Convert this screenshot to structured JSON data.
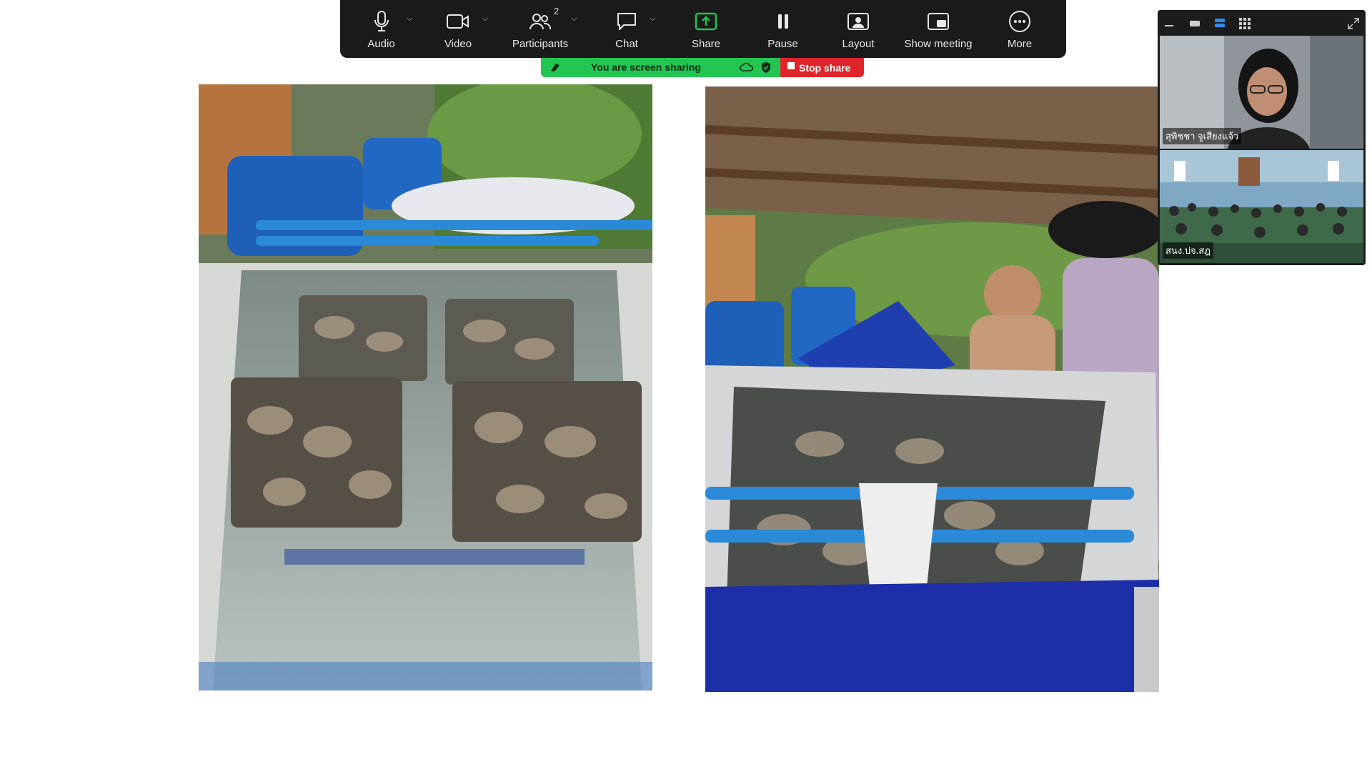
{
  "toolbar": {
    "audio": "Audio",
    "video": "Video",
    "participants": "Participants",
    "participants_count": "2",
    "chat": "Chat",
    "share": "Share",
    "pause": "Pause",
    "layout": "Layout",
    "show_meeting": "Show meeting",
    "more": "More"
  },
  "banner": {
    "sharing_text": "You are screen sharing",
    "stop_label": "Stop share"
  },
  "colors": {
    "toolbar_bg": "#1a1a1a",
    "share_accent": "#23c552",
    "stop_red": "#e0242c"
  },
  "videos": {
    "participant1_name": "สุพิชชา จูเสียงแจ้ว",
    "participant2_name": "สนง.ปจ.สฎ"
  },
  "icons": [
    "microphone-icon",
    "camera-icon",
    "participants-icon",
    "chat-icon",
    "share-screen-icon",
    "pause-icon",
    "layout-icon",
    "show-meeting-icon",
    "more-icon",
    "shield-icon",
    "cloud-icon",
    "stop-icon",
    "minimize-icon",
    "speaker-view-icon",
    "gallery-view-icon",
    "expand-icon"
  ]
}
